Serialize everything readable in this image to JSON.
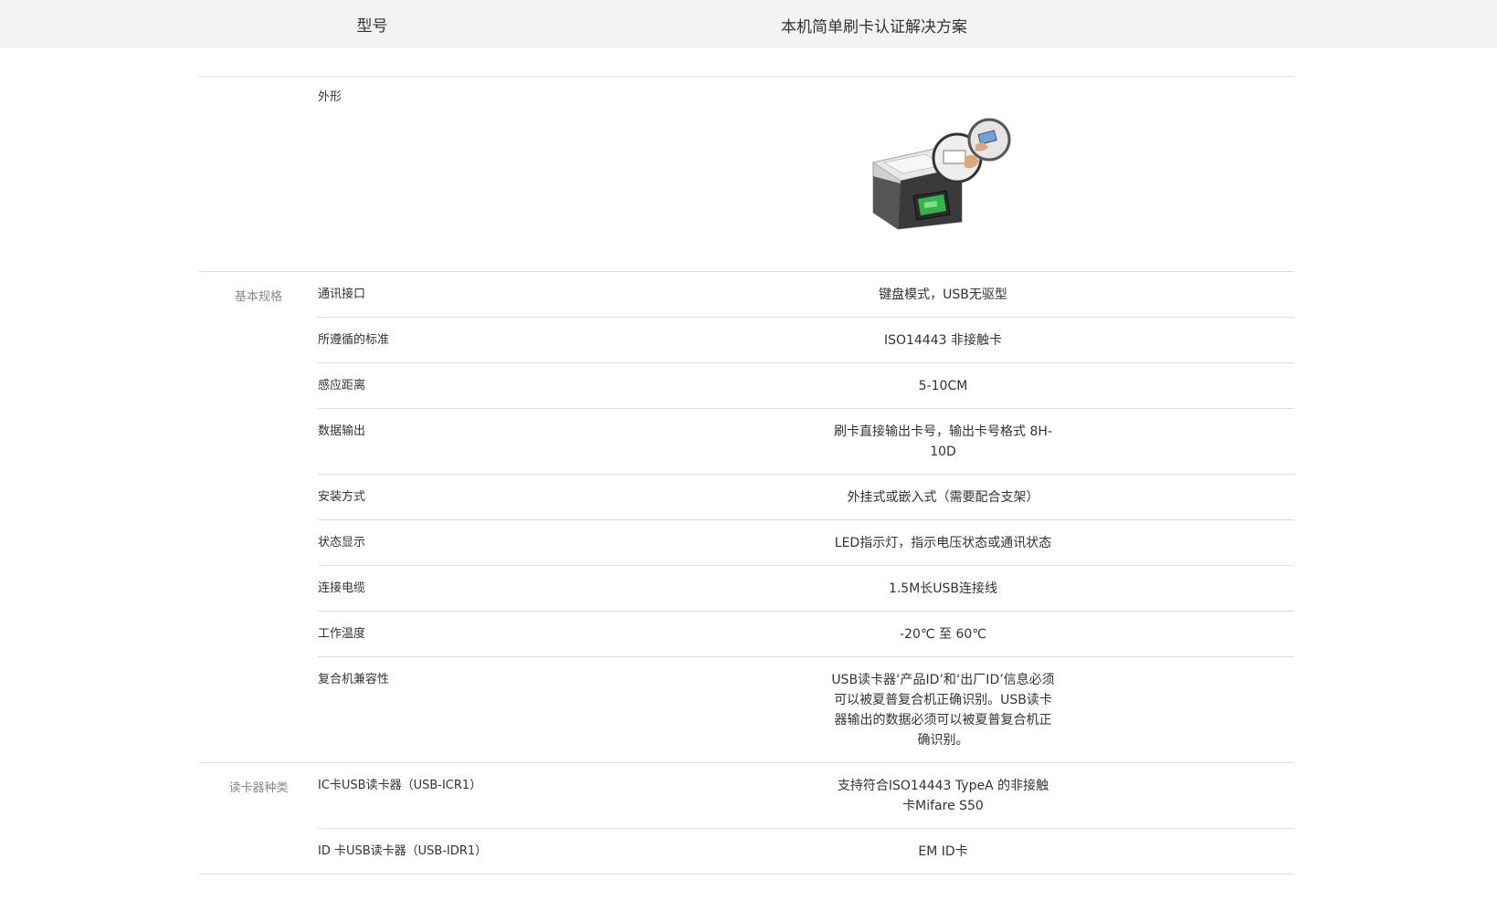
{
  "header": {
    "col1": "型号",
    "col2": "本机简单刷卡认证解决方案"
  },
  "shape": {
    "label": "外形",
    "image_icon": "card-reader-copier-image"
  },
  "groups": [
    {
      "label": "基本规格",
      "rows": [
        {
          "label": "通讯接口",
          "value": "键盘模式，USB无驱型"
        },
        {
          "label": "所遵循的标准",
          "value": "ISO14443 非接触卡"
        },
        {
          "label": "感应距离",
          "value": "5-10CM"
        },
        {
          "label": "数据输出",
          "value": "刷卡直接输出卡号，输出卡号格式 8H-10D"
        },
        {
          "label": "安装方式",
          "value": "外挂式或嵌入式（需要配合支架）"
        },
        {
          "label": "状态显示",
          "value": "LED指示灯，指示电压状态或通讯状态"
        },
        {
          "label": "连接电缆",
          "value": "1.5M长USB连接线"
        },
        {
          "label": "工作温度",
          "value": "-20℃ 至 60℃"
        },
        {
          "label": "复合机兼容性",
          "value": "USB读卡器‘产品ID’和‘出厂ID’信息必须可以被夏普复合机正确识别。USB读卡器输出的数据必须可以被夏普复合机正确识别。"
        }
      ]
    },
    {
      "label": "读卡器种类",
      "rows": [
        {
          "label": "IC卡USB读卡器（USB-ICR1）",
          "value": "支持符合ISO14443 TypeA 的非接触卡Mifare S50"
        },
        {
          "label": "ID 卡USB读卡器（USB-IDR1）",
          "value": "EM ID卡"
        }
      ]
    }
  ]
}
